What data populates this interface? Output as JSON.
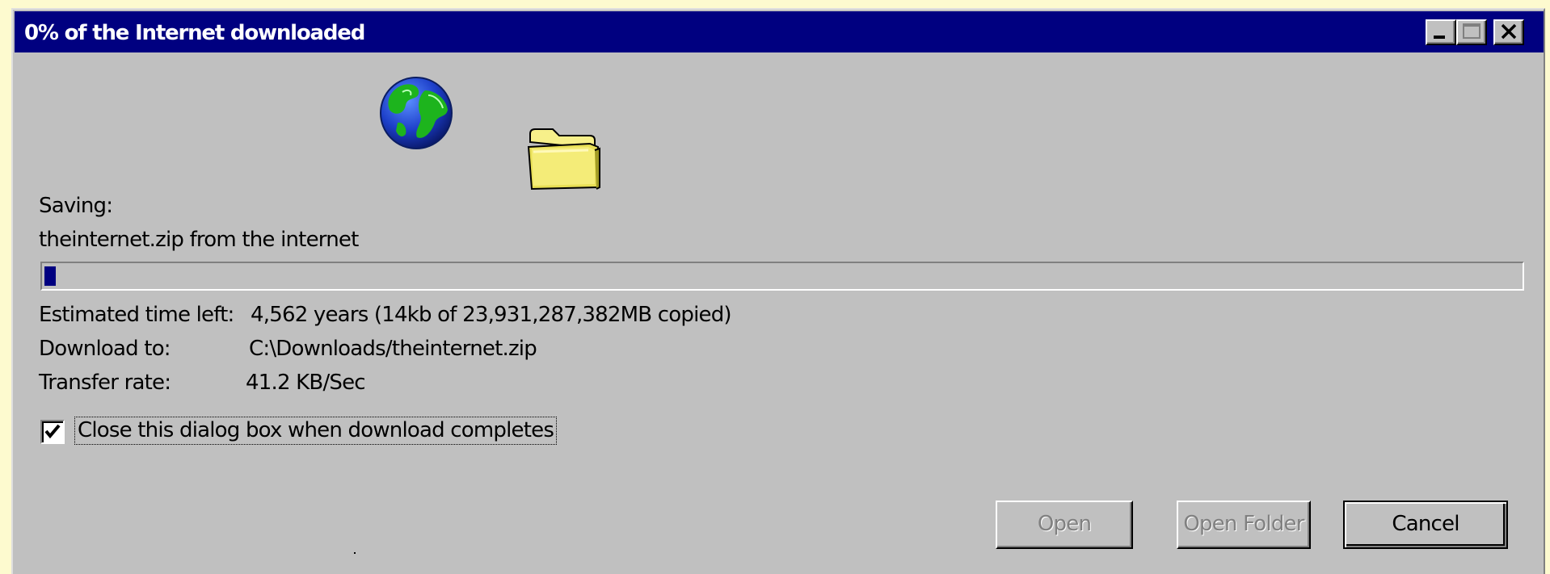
{
  "window": {
    "title": "0% of the Internet downloaded",
    "controls": {
      "minimize_icon": "minimize-icon",
      "maximize_icon": "maximize-icon",
      "close_icon": "close-icon"
    }
  },
  "animation": {
    "source_icon": "globe-icon",
    "destination_icon": "folder-icon"
  },
  "status": {
    "saving_label": "Saving:",
    "file_description": "theinternet.zip from the internet"
  },
  "progress": {
    "percent": 0,
    "display_fraction": 0.006,
    "fill_color": "#000080"
  },
  "details": {
    "time_left_label": "Estimated time left:",
    "time_left_value": "4,562 years (14kb of 23,931,287,382MB copied)",
    "download_to_label": "Download to:",
    "download_to_value": "C:\\Downloads/theinternet.zip",
    "transfer_rate_label": "Transfer rate:",
    "transfer_rate_value": "41.2 KB/Sec"
  },
  "options": {
    "close_when_done_label": "Close this dialog box when download completes",
    "close_when_done_checked": true
  },
  "buttons": {
    "open_label": "Open",
    "open_folder_label": "Open Folder",
    "cancel_label": "Cancel"
  },
  "colors": {
    "titlebar": "#000080",
    "dialog_face": "#c0c0c0",
    "desktop": "#fdfacf"
  }
}
